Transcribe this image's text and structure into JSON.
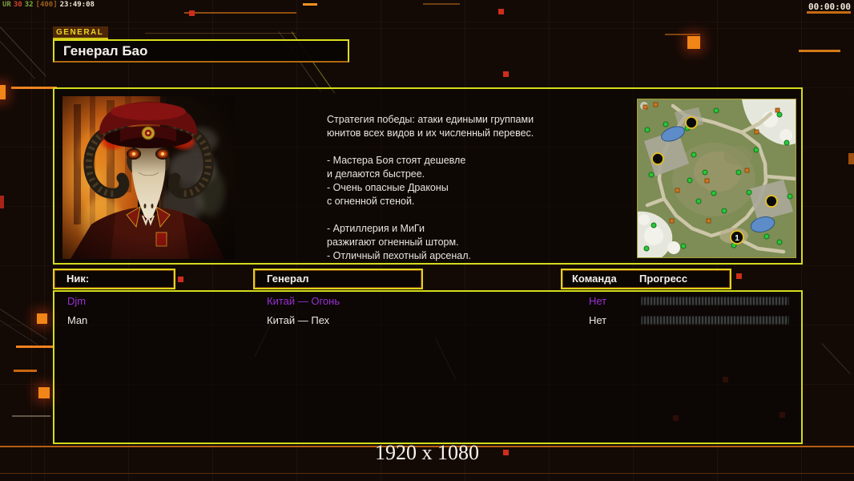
{
  "status_bar": {
    "segments": [
      {
        "text": "UR",
        "color": "#7d9c42"
      },
      {
        "text": "30",
        "color": "#cf4530"
      },
      {
        "text": "32",
        "color": "#7fae3a"
      },
      {
        "text": "[400]",
        "color": "#9c5e20"
      },
      {
        "text": "23:49:08",
        "color": "#eee6d4"
      }
    ],
    "timer": "00:00:00"
  },
  "header": {
    "tab_label": "GENERAL",
    "title": "Генерал Бао"
  },
  "info_panel": {
    "portrait_icon": "general-bao-demon-portrait",
    "strategy_text": "Стратегия победы: атаки едиными группами\nюнитов всех видов и их численный перевес.\n\n- Мастера Боя стоят дешевле\nи делаются быстрее.\n- Очень опасные Драконы\nс огненной стеной.\n\n- Артиллерия и МиГи\nразжигают огненный шторм.\n- Отличный пехотный арсенал.",
    "minimap": {
      "start_marker": "1"
    }
  },
  "columns": {
    "nick": "Ник:",
    "general": "Генерал",
    "team": "Команда",
    "progress": "Прогресс"
  },
  "players": [
    {
      "nick": "Djm",
      "general": "Китай — Огонь",
      "team": "Нет",
      "progress_percent": 0,
      "text_color": "#9a2fd6"
    },
    {
      "nick": "Man",
      "general": "Китай — Пех",
      "team": "Нет",
      "progress_percent": 0,
      "text_color": "#efe9e1"
    }
  ],
  "footer": {
    "resolution": "1920 x 1080"
  },
  "colors": {
    "accent_yellow": "#d4dc1c",
    "accent_orange": "#ef8320",
    "player_purple": "#9a2fd6",
    "status_red": "#cf2d1c",
    "panel_bg": "#0b0603"
  }
}
